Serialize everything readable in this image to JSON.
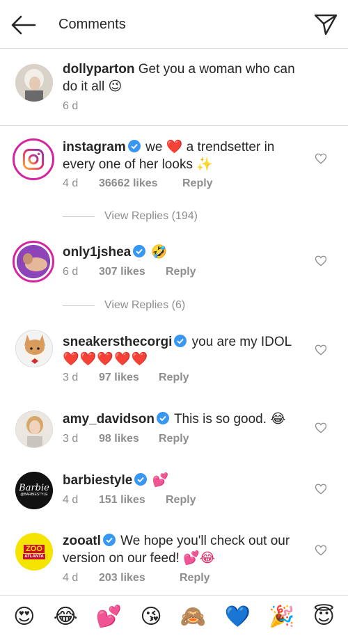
{
  "header": {
    "title": "Comments",
    "back_icon": "arrow-left-icon",
    "send_icon": "paper-plane-icon"
  },
  "caption": {
    "username": "dollyparton",
    "text": "Get you a woman who can do it all",
    "emoji": "😉",
    "time": "6 d"
  },
  "comments": [
    {
      "username": "instagram",
      "verified": true,
      "text_a": "we",
      "emoji_a": "❤️",
      "text_b": "a trendsetter in every one of her looks",
      "emoji_b": "✨",
      "time": "4 d",
      "likes": "36662 likes",
      "reply": "Reply",
      "view_replies": "View Replies (194)"
    },
    {
      "username": "only1jshea",
      "verified": true,
      "emoji_a": "🤣",
      "time": "6 d",
      "likes": "307 likes",
      "reply": "Reply",
      "view_replies": "View Replies (6)"
    },
    {
      "username": "sneakersthecorgi",
      "verified": true,
      "text_a": "you are my IDOL",
      "emoji_a": "❤️❤️❤️❤️❤️",
      "time": "3 d",
      "likes": "97 likes",
      "reply": "Reply"
    },
    {
      "username": "amy_davidson",
      "verified": true,
      "text_a": "This is so good.",
      "emoji_a": "😂",
      "time": "3 d",
      "likes": "98 likes",
      "reply": "Reply"
    },
    {
      "username": "barbiestyle",
      "verified": true,
      "emoji_a": "💕",
      "time": "4 d",
      "likes": "151 likes",
      "reply": "Reply",
      "avatar_text_a": "Barbie",
      "avatar_text_b": "@BARBIESTYLE"
    },
    {
      "username": "zooatl",
      "verified": true,
      "text_a": "We hope you'll check out our version on our feed!",
      "emoji_a": "💕😂",
      "time": "4 d",
      "likes": "203 likes",
      "reply": "Reply",
      "avatar_text_a": "ZOO",
      "avatar_text_b": "ATLANTA"
    }
  ],
  "emoji_bar": [
    "😍",
    "😂",
    "💕",
    "😘",
    "🙈",
    "💙",
    "🎉",
    "😇"
  ],
  "colors": {
    "text": "#262626",
    "muted": "#8e8e8e",
    "verified": "#3897f0",
    "heart": "#ed4956"
  }
}
